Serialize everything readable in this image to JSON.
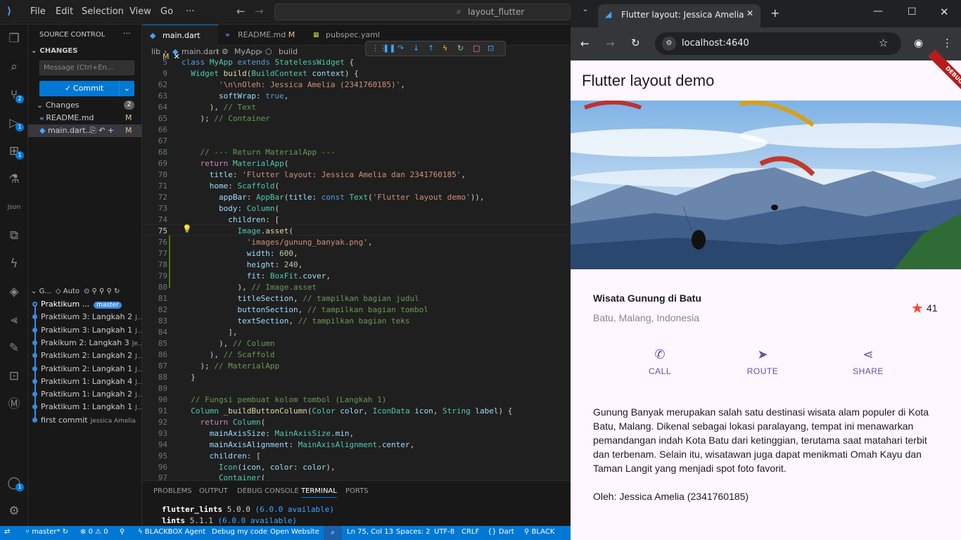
{
  "vscode": {
    "menu": [
      "File",
      "Edit",
      "Selection",
      "View",
      "Go",
      "···"
    ],
    "search": "layout_flutter",
    "sidebar": {
      "header": "SOURCE CONTROL",
      "changes_title": "CHANGES",
      "message_placeholder": "Message (Ctrl+En...",
      "commit_label": "Commit",
      "changes_group": "Changes",
      "changes_count": "2",
      "files": [
        {
          "name": "README.md",
          "status": "M"
        },
        {
          "name": "main.dart...",
          "status": "M"
        }
      ],
      "graph_title": "G...",
      "graph_auto": "Auto",
      "commits": [
        {
          "msg": "Praktikum ...",
          "extra": "master"
        },
        {
          "msg": "Praktikum 3: Langkah 2",
          "extra": "J..."
        },
        {
          "msg": "Praktikum 3: Langkah 1",
          "extra": "J..."
        },
        {
          "msg": "Prakikum 2: Langkah 3",
          "extra": "Je..."
        },
        {
          "msg": "Praktikum 2: Langkah 2",
          "extra": "J..."
        },
        {
          "msg": "Praktikum 2: Langkah 1",
          "extra": "J..."
        },
        {
          "msg": "Praktikum 1: Langkah 4",
          "extra": "J..."
        },
        {
          "msg": "Praktikum 1: Langkah 2",
          "extra": "J..."
        },
        {
          "msg": "Praktikum 1: Langkah 1",
          "extra": "J..."
        },
        {
          "msg": "first commit",
          "extra": "Jessica Amelia"
        }
      ]
    },
    "tabs": [
      {
        "label": "main.dart",
        "status": "M"
      },
      {
        "label": "README.md",
        "status": "M"
      },
      {
        "label": "pubspec.yaml",
        "status": ""
      }
    ],
    "breadcrumb": [
      "lib",
      "main.dart",
      "MyApp",
      "build"
    ],
    "lines": [
      "5",
      "9",
      "62",
      "63",
      "64",
      "65",
      "66",
      "67",
      "68",
      "69",
      "70",
      "71",
      "72",
      "73",
      "74",
      "75",
      "76",
      "77",
      "78",
      "79",
      "80",
      "81",
      "82",
      "83",
      "84",
      "85",
      "86",
      "87",
      "88",
      "89",
      "90",
      "91",
      "92",
      "93",
      "94",
      "95",
      "96",
      "97"
    ],
    "panel_tabs": [
      "PROBLEMS",
      "OUTPUT",
      "DEBUG CONSOLE",
      "TERMINAL",
      "PORTS"
    ],
    "terminal": [
      {
        "pkg": "flutter_lints",
        "ver": "5.0.0",
        "avail": "(6.0.0 available)"
      },
      {
        "pkg": "lints",
        "ver": "5.1.1",
        "avail": "(6.0.0 available)"
      }
    ],
    "status": {
      "branch": "master*",
      "problems": "0",
      "warnings": "0",
      "blackbox": "BLACKBOX Agent",
      "debug": "Debug my code",
      "open": "Open Website",
      "pos": "Ln 75, Col 13",
      "spaces": "Spaces: 2",
      "enc": "UTF-8",
      "eol": "CRLF",
      "lang": "Dart",
      "bb2": "BLACK"
    }
  },
  "chrome": {
    "tab_title": "Flutter layout: Jessica Amelia da",
    "url": "localhost:4640",
    "app": {
      "appbar_title": "Flutter layout demo",
      "debug": "DEBUG",
      "title": "Wisata Gunung di Batu",
      "subtitle": "Batu, Malang, Indonesia",
      "rating": "41",
      "buttons": [
        {
          "label": "CALL",
          "icon": "phone-icon"
        },
        {
          "label": "ROUTE",
          "icon": "navigation-icon"
        },
        {
          "label": "SHARE",
          "icon": "share-icon"
        }
      ],
      "text": "Gunung Banyak merupakan salah satu destinasi wisata alam populer di Kota Batu, Malang. Dikenal sebagai lokasi paralayang, tempat ini menawarkan pemandangan indah Kota Batu dari ketinggian, terutama saat matahari terbit dan terbenam. Selain itu, wisatawan juga dapat menikmati Omah Kayu dan Taman Langit yang menjadi spot foto favorit.",
      "author": "Oleh: Jessica Amelia (2341760185)",
      "accent": "#6750a4",
      "star_color": "#f44336"
    }
  }
}
